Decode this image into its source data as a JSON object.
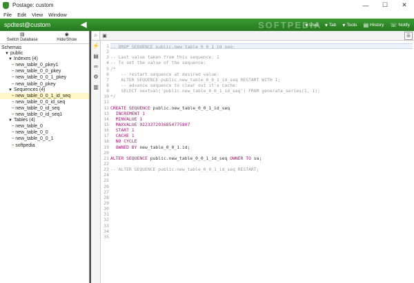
{
  "window": {
    "title": "Postage: custom",
    "minimize": "—",
    "maximize": "☐",
    "close": "✕"
  },
  "menu": [
    "File",
    "Edit",
    "View",
    "Window"
  ],
  "header": {
    "connection": "spdtest@custom",
    "back": "◀",
    "watermark": "SOFTPEDIA",
    "buttons": [
      {
        "icon": "user-icon",
        "label": "User"
      },
      {
        "icon": "tab-icon",
        "label": "Tab"
      },
      {
        "icon": "tools-icon",
        "label": "Tools"
      },
      {
        "icon": "history-icon",
        "label": "History"
      },
      {
        "icon": "notify-icon",
        "label": "Notify"
      }
    ]
  },
  "sidebar": {
    "switch_label": "Switch Database",
    "hide_label": "Hide/Show",
    "tree": [
      {
        "text": "Schemas",
        "indent": 0,
        "tri": "",
        "leaf": false
      },
      {
        "text": "public",
        "indent": 1,
        "tri": "▼",
        "leaf": false
      },
      {
        "text": "Indexes (4)",
        "indent": 2,
        "tri": "▼",
        "leaf": false
      },
      {
        "text": "new_table_0_pkey1",
        "indent": 3,
        "tri": "",
        "leaf": true
      },
      {
        "text": "new_table_0_0_pkey",
        "indent": 3,
        "tri": "",
        "leaf": true
      },
      {
        "text": "new_table_0_0_1_pkey",
        "indent": 3,
        "tri": "",
        "leaf": true
      },
      {
        "text": "new_table_0_pkey",
        "indent": 3,
        "tri": "",
        "leaf": true
      },
      {
        "text": "Sequences (4)",
        "indent": 2,
        "tri": "▼",
        "leaf": false
      },
      {
        "text": "new_table_0_0_1_id_seq",
        "indent": 3,
        "tri": "",
        "leaf": true,
        "selected": true
      },
      {
        "text": "new_table_0_0_id_seq",
        "indent": 3,
        "tri": "",
        "leaf": true
      },
      {
        "text": "new_table_0_id_seq",
        "indent": 3,
        "tri": "",
        "leaf": true
      },
      {
        "text": "new_table_0_id_seq1",
        "indent": 3,
        "tri": "",
        "leaf": true
      },
      {
        "text": "Tables (4)",
        "indent": 2,
        "tri": "▼",
        "leaf": false
      },
      {
        "text": "new_table_0",
        "indent": 3,
        "tri": "",
        "leaf": true
      },
      {
        "text": "new_table_0_0",
        "indent": 3,
        "tri": "",
        "leaf": true
      },
      {
        "text": "new_table_0_0_1",
        "indent": 3,
        "tri": "",
        "leaf": true
      },
      {
        "text": "softpedia",
        "indent": 3,
        "tri": "",
        "leaf": true
      }
    ]
  },
  "editor": {
    "line_count": 35,
    "lines": [
      [
        [
          "cmt",
          "-- DROP SEQUENCE public.new_table_0_0_1_id_seq;"
        ]
      ],
      [],
      [
        [
          "cmt",
          "-- Last value taken from this sequence: 1"
        ]
      ],
      [
        [
          "cmt",
          "-- To set the value of the sequence:"
        ]
      ],
      [
        [
          "cmt",
          "/*"
        ]
      ],
      [
        [
          "cmt",
          "    -- restart sequence at desired value:"
        ]
      ],
      [
        [
          "cmt",
          "    ALTER SEQUENCE public.new_table_0_0_1_id_seq RESTART WITH 1;"
        ]
      ],
      [
        [
          "cmt",
          "    -- advance sequence to clear out it's cache:"
        ]
      ],
      [
        [
          "cmt",
          "    SELECT nextval('public.new_table_0_0_1_id_seq') FROM generate_series(1, 1);"
        ]
      ],
      [
        [
          "cmt",
          "*/"
        ]
      ],
      [],
      [
        [
          "kw",
          "CREATE SEQUENCE "
        ],
        [
          "tx",
          "public.new_table_0_0_1_id_seq"
        ]
      ],
      [
        [
          "kw",
          "  INCREMENT 1"
        ]
      ],
      [
        [
          "kw",
          "  MINVALUE 1"
        ]
      ],
      [
        [
          "kw",
          "  MAXVALUE 9223372036854775807"
        ]
      ],
      [
        [
          "kw",
          "  START 1"
        ]
      ],
      [
        [
          "kw",
          "  CACHE 1"
        ]
      ],
      [
        [
          "kw",
          "  NO CYCLE"
        ]
      ],
      [
        [
          "kw",
          "  OWNED BY "
        ],
        [
          "tx",
          "new_table_0_0_1.id;"
        ]
      ],
      [],
      [
        [
          "kw",
          "ALTER SEQUENCE "
        ],
        [
          "tx",
          "public.new_table_0_0_1_id_seq "
        ],
        [
          "kw",
          "OWNER TO "
        ],
        [
          "tx",
          "sa;"
        ]
      ],
      [],
      [
        [
          "cmt",
          "-- ALTER SEQUENCE public.new_table_0_0_1_id_seq RESTART;"
        ]
      ]
    ]
  },
  "colors": {
    "header_green": "#2e8a26",
    "keyword": "#a0146f",
    "comment": "#9a9a9a",
    "selected_row": "#fff6c8"
  }
}
